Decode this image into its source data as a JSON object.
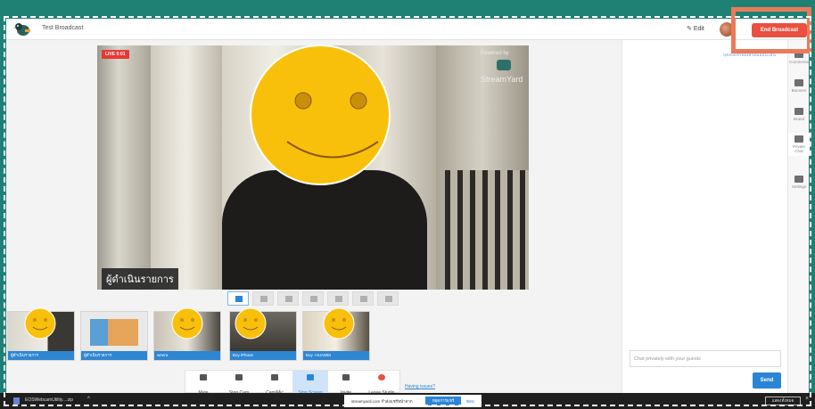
{
  "header": {
    "title": "Test Broadcast",
    "edit_label": "Edit",
    "end_broadcast_label": "End Broadcast"
  },
  "stage": {
    "live_badge": "LIVE 0:01",
    "powered_by": "Powered by",
    "brand": "StreamYard",
    "name_tag": "ผู้ดำเนินรายการ"
  },
  "chat": {
    "note": "บุคคลเหรียณพร้อมออนไลน์",
    "input_placeholder": "Chat privately with your guests",
    "send_label": "Send"
  },
  "rail": [
    {
      "label": "Comments",
      "icon": "comment-icon"
    },
    {
      "label": "Banners",
      "icon": "banner-icon"
    },
    {
      "label": "Brand",
      "icon": "palette-icon"
    },
    {
      "label": "Private Chat",
      "icon": "private-chat-icon"
    },
    {
      "label": "Settings",
      "icon": "gear-icon"
    }
  ],
  "participants": [
    {
      "name": "ผู้ดำเนินรายการ",
      "kind": "camera"
    },
    {
      "name": "ผู้ดำเนินรายการ",
      "kind": "screen"
    },
    {
      "name": "weera",
      "kind": "camera"
    },
    {
      "name": "Boy iPhone",
      "kind": "camera"
    },
    {
      "name": "Boy -HUAWEI",
      "kind": "camera"
    }
  ],
  "controls": [
    {
      "label": "Mute",
      "icon": "mic-icon"
    },
    {
      "label": "Stop Cam",
      "icon": "camera-icon"
    },
    {
      "label": "Cam/Mic",
      "icon": "gear-icon"
    },
    {
      "label": "Stop Screen",
      "icon": "screen-icon"
    },
    {
      "label": "Invite",
      "icon": "add-person-icon"
    },
    {
      "label": "Leave Studio",
      "icon": "close-circle-icon"
    }
  ],
  "having_issues": "Having issues?",
  "taskbar": {
    "download_name": "EOSWebcamUtility....zip",
    "chevron": "^",
    "share_text": "streamyard.com กำลังแชร์หน้าจาก",
    "stop_share": "หยุดการแชร์",
    "hide": "ซ่อน",
    "show_all": "แสดงทั้งหมด",
    "close": "×"
  },
  "colors": {
    "accent": "#2b85d6",
    "danger": "#e9503f",
    "highlight": "#ec7a5a",
    "background": "#1f8174",
    "smiley": "#f9c00b"
  }
}
